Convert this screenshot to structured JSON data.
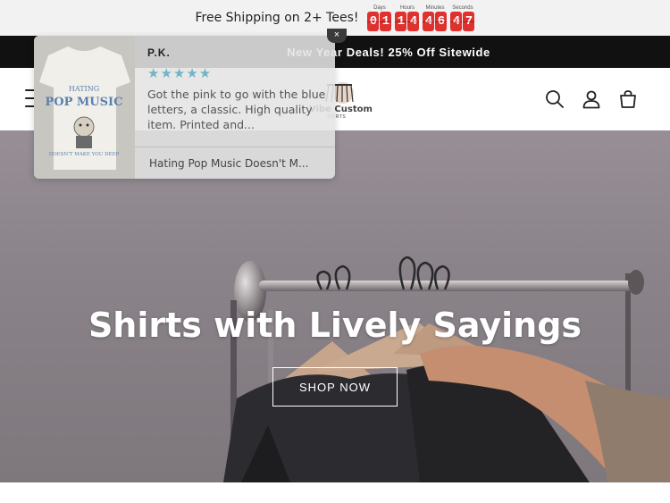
{
  "countdown": {
    "text": "Free Shipping on 2+ Tees!",
    "units": [
      {
        "label": "Days",
        "digits": [
          "0",
          "1"
        ]
      },
      {
        "label": "Hours",
        "digits": [
          "1",
          "4"
        ]
      },
      {
        "label": "Minutes",
        "digits": [
          "4",
          "6"
        ]
      },
      {
        "label": "Seconds",
        "digits": [
          "4",
          "7"
        ]
      }
    ],
    "digit_color": "#e0312f"
  },
  "announcement": {
    "text": "New Year Deals!  25% Off Sitewide"
  },
  "header": {
    "logo_text": "Vibe Custom",
    "logo_sub": "SHIRTS",
    "icons": [
      "menu-icon",
      "search-icon",
      "account-icon",
      "cart-icon"
    ]
  },
  "hero": {
    "title": "Shirts with Lively Sayings",
    "button_label": "SHOP NOW"
  },
  "review_popup": {
    "author": "P.K.",
    "stars": "★★★★★",
    "review": "Got the pink to go with the blue letters, a classic. High quality item. Printed and...",
    "product": "Hating Pop Music Doesn't M...",
    "close_label": "×",
    "image_text_top": "HATING",
    "image_text_main": "POP MUSIC",
    "image_text_bottom": "DOESN'T MAKE YOU DEEP",
    "star_color": "#6fb6c6"
  }
}
